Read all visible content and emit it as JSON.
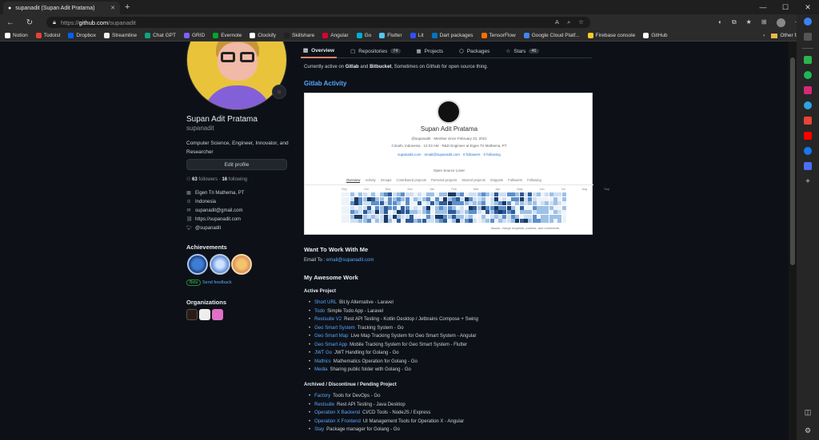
{
  "browser": {
    "tab_title": "supanadit (Supan Adit Pratama)",
    "url_prefix": "https://",
    "url_host": "github.com",
    "url_path": "/supanadit"
  },
  "bookmarks": [
    "Notion",
    "Todoist",
    "Dropbox",
    "Streamline",
    "Chat GPT",
    "GRID",
    "Evernote",
    "Clockify",
    "Skillshare",
    "Angular",
    "Go",
    "Flutter",
    "Lit",
    "Dart packages",
    "TensorFlow",
    "Google Cloud Platf...",
    "Firebase console",
    "GitHub"
  ],
  "bookmark_colors": [
    "#ffffff",
    "#e44332",
    "#0061ff",
    "#f0f0f0",
    "#10a37f",
    "#7b61ff",
    "#00a82d",
    "#ffffff",
    "#222222",
    "#dd0031",
    "#00add8",
    "#54c5f8",
    "#324fff",
    "#0175c2",
    "#ff6f00",
    "#4285f4",
    "#ffca28",
    "#ffffff"
  ],
  "other_favorites": "Other favorites",
  "profile": {
    "name": "Supan Adit Pratama",
    "login": "supanadit",
    "bio": "Computer Science, Engineer, Innovator, and Researcher",
    "edit_label": "Edit profile",
    "followers_count": "63",
    "followers_label": "followers",
    "following_count": "16",
    "following_label": "following",
    "company": "Eigen Tri Mathema, PT",
    "location": "Indonesia",
    "email": "supanadit@gmail.com",
    "website": "https://supanadit.com",
    "twitter": "@supanadit"
  },
  "achievements": {
    "title": "Achievements",
    "beta": "Beta",
    "feedback": "Send feedback"
  },
  "organizations": {
    "title": "Organizations"
  },
  "tabs": [
    {
      "label": "Overview",
      "count": ""
    },
    {
      "label": "Repositories",
      "count": "74"
    },
    {
      "label": "Projects",
      "count": ""
    },
    {
      "label": "Packages",
      "count": ""
    },
    {
      "label": "Stars",
      "count": "46"
    }
  ],
  "readme": {
    "intro_pre": "Currently active on ",
    "intro_b1": "Gitlab",
    "intro_mid": " and ",
    "intro_b2": "Bitbucket",
    "intro_post": ", Sometimes on Github for open source thing.",
    "gitlab_heading": "Gitlab Activity",
    "work_heading": "Want To Work With Me",
    "email_label": "Email To :",
    "email_link": "email@supanadit.com",
    "awesome_heading": "My Awesome Work",
    "active_heading": "Active Project",
    "active": [
      {
        "link": "Short URL",
        "text": "Bit.ly Alternative - Laravel"
      },
      {
        "link": "Todo",
        "text": "Simple Todo App - Laravel"
      },
      {
        "link": "Restsuite V2",
        "text": "Rest API Testing - Kotlin Desktop / Jetbrains Compose + Swing"
      },
      {
        "link": "Geo Smart System",
        "text": "Tracking System - Go"
      },
      {
        "link": "Geo Smart Map",
        "text": "Live Map Tracking System for Geo Smart System - Angular"
      },
      {
        "link": "Geo Smart App",
        "text": "Mobile Tracking System for Geo Smart System - Flutter"
      },
      {
        "link": "JWT Go",
        "text": "JWT Handling for Golang - Go"
      },
      {
        "link": "Mathics",
        "text": "Mathematics Operation for Golang - Go"
      },
      {
        "link": "Media",
        "text": "Sharing public folder with Golang - Go"
      }
    ],
    "archived_heading": "Archived / Discontinue / Pending Project",
    "archived": [
      {
        "link": "Factory",
        "text": "Tools for DevOps - Go"
      },
      {
        "link": "Restsuite",
        "text": "Rest API Testing - Java Desktop"
      },
      {
        "link": "Operation X Backend",
        "text": "CI/CD Tools - NodeJS / Express"
      },
      {
        "link": "Operation X Frontend",
        "text": "UI Management Tools for Operation X - Angular"
      },
      {
        "link": "Stay",
        "text": "Package manager for Golang - Go"
      }
    ]
  },
  "gitlab_card": {
    "name": "Supan Adit Pratama",
    "meta1": "@supanadit  ·  Member since February 22, 2021",
    "meta2": "Cimahi, Indonesia  ·  12:23 AM  ·  R&D Engineer at Eigen Tri Mathema, PT",
    "meta3": "supanadit.com  ·  email@supanadit.com  ·  0 followers  ·  0 following",
    "desc": "Open Source Lover",
    "tabs": [
      "Overview",
      "Activity",
      "Groups",
      "Contributed projects",
      "Personal projects",
      "Starred projects",
      "Snippets",
      "Followers",
      "Following"
    ],
    "months": [
      "Sep",
      "Oct",
      "Nov",
      "Dec",
      "Jan",
      "Feb",
      "Mar",
      "Apr",
      "May",
      "Jun",
      "Jul",
      "Aug",
      "Sep"
    ],
    "legend": "Issues, merge requests, pushes, and comments."
  }
}
